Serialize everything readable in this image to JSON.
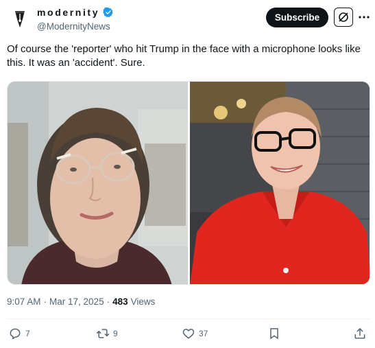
{
  "author": {
    "display_name": "modernity",
    "handle": "@ModernityNews",
    "avatar_icon": "pen-nib-logo",
    "verified_icon": "verified-badge-icon",
    "verified_color": "#1d9bf0"
  },
  "header": {
    "subscribe_label": "Subscribe",
    "grok_icon": "grok-icon",
    "more_icon": "more-icon"
  },
  "tweet": {
    "text": "Of course the 'reporter' who hit Trump in the face with a microphone looks like this. It was an 'accident'. Sure."
  },
  "media": {
    "left_photo_icon": "portrait-photo",
    "right_photo_icon": "portrait-photo"
  },
  "meta": {
    "time": "9:07 AM",
    "separator": "·",
    "date": "Mar 17, 2025",
    "views_count": "483",
    "views_label": "Views"
  },
  "actions": {
    "replies": "7",
    "reposts": "9",
    "likes": "37"
  },
  "colors": {
    "text_primary": "#0f1419",
    "text_secondary": "#536471",
    "button_dark": "#0f1419"
  }
}
